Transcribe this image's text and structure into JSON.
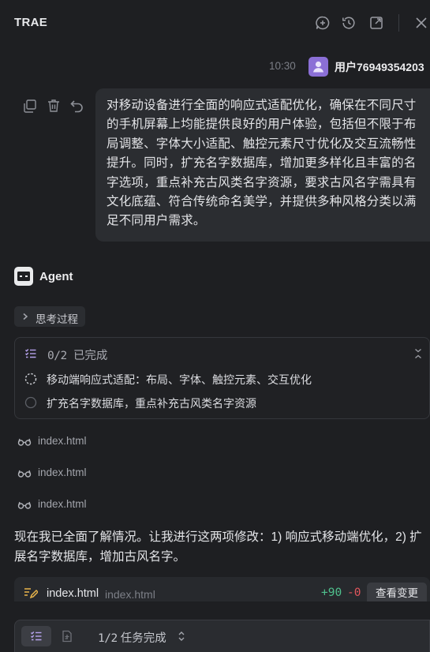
{
  "window": {
    "title": "TRAE",
    "toolbar_icons": [
      "new-chat-icon",
      "history-icon",
      "open-external-icon",
      "close-icon"
    ]
  },
  "user_message": {
    "time": "10:30",
    "username": "用户76949354203",
    "avatar_color": "#8b6fd6",
    "text": "对移动设备进行全面的响应式适配优化，确保在不同尺寸的手机屏幕上均能提供良好的用户体验，包括但不限于布局调整、字体大小适配、触控元素尺寸优化及交互流畅性提升。同时，扩充名字数据库，增加更多样化且丰富的名字选项，重点补充古风类名字资源，要求古风名字需具有文化底蕴、符合传统命名美学，并提供多种风格分类以满足不同用户需求。",
    "action_icons": [
      "copy-icon",
      "delete-icon",
      "undo-icon"
    ]
  },
  "agent": {
    "name": "Agent",
    "thinking_label": "思考过程",
    "task_card": {
      "status_count": "0/2",
      "status_label": "已完成",
      "items": [
        {
          "label": "移动端响应式适配：布局、字体、触控元素、交互优化",
          "state": "in-progress"
        },
        {
          "label": "扩充名字数据库，重点补充古风类名字资源",
          "state": "pending"
        }
      ]
    },
    "file_reads": [
      "index.html",
      "index.html",
      "index.html"
    ],
    "message": "现在我已全面了解情况。让我进行这两项修改：1) 响应式移动端优化，2) 扩展名字数据库，增加古风名字。",
    "diff": {
      "file_name": "index.html",
      "file_path": "index.html",
      "additions": "+90",
      "deletions": "-0",
      "view_label": "查看变更"
    }
  },
  "composer": {
    "progress_count": "1/2",
    "progress_label": "任务完成"
  },
  "colors": {
    "background": "#1e1f22",
    "bubble": "#2b2d31",
    "accent_purple": "#b7a3ee",
    "add_green": "#4fc08d",
    "delete_red": "#e0555c"
  }
}
